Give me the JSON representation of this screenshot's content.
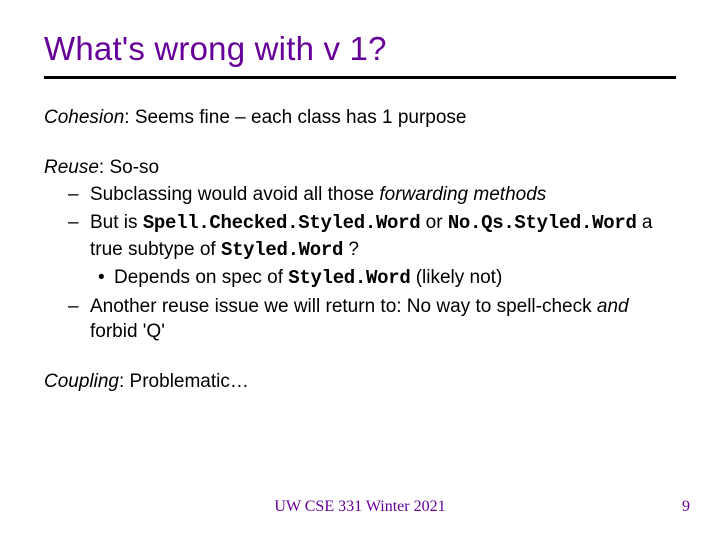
{
  "title": "What's wrong with v 1?",
  "cohesion": {
    "label": "Cohesion",
    "text": ": Seems fine – each class has 1 purpose"
  },
  "reuse": {
    "label": "Reuse",
    "intro": ": So-so",
    "b1a": "Subclassing would avoid all those ",
    "b1b": "forwarding methods",
    "b2a": "But is ",
    "code1": "Spell.Checked.Styled.Word",
    "b2b": " or ",
    "code2": "No.Qs.Styled.Word",
    "b2c": "a true subtype of ",
    "code3": "Styled.Word",
    "b2d": " ?",
    "sub_a": "Depends on spec of ",
    "code4": "Styled.Word",
    "sub_b": " (likely not)",
    "b3a": "Another reuse issue we will return to: No way to spell-check ",
    "b3b": "and",
    "b3c": " forbid 'Q'"
  },
  "coupling": {
    "label": "Coupling",
    "text": ": Problematic…"
  },
  "footer": "UW CSE 331 Winter 2021",
  "page": "9"
}
